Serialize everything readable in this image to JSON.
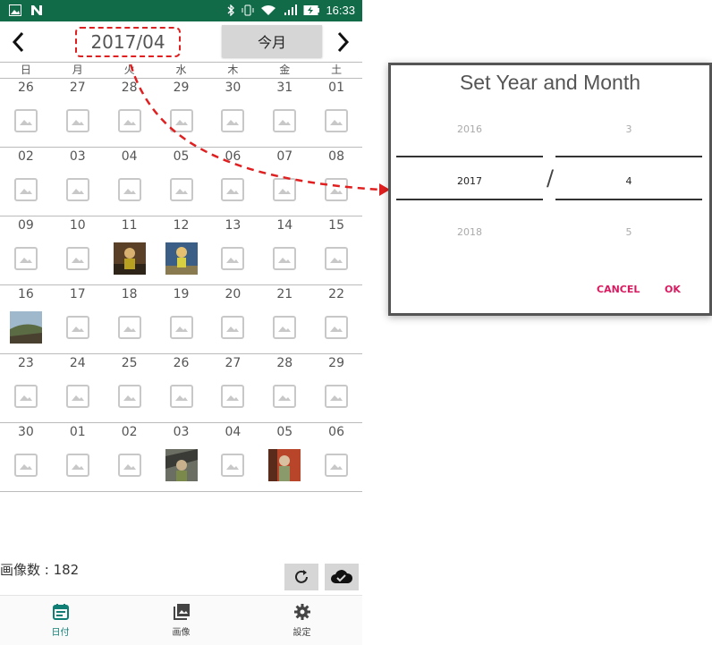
{
  "status_bar": {
    "time": "16:33"
  },
  "header": {
    "year_month": "2017/04",
    "today_button": "今月"
  },
  "calendar": {
    "weekdays": [
      "日",
      "月",
      "火",
      "水",
      "木",
      "金",
      "土"
    ],
    "weeks": [
      [
        "26",
        "27",
        "28",
        "29",
        "30",
        "31",
        "01"
      ],
      [
        "02",
        "03",
        "04",
        "05",
        "06",
        "07",
        "08"
      ],
      [
        "09",
        "10",
        "11",
        "12",
        "13",
        "14",
        "15"
      ],
      [
        "16",
        "17",
        "18",
        "19",
        "20",
        "21",
        "22"
      ],
      [
        "23",
        "24",
        "25",
        "26",
        "27",
        "28",
        "29"
      ],
      [
        "30",
        "01",
        "02",
        "03",
        "04",
        "05",
        "06"
      ]
    ]
  },
  "footer": {
    "image_count": "画像数 : 182"
  },
  "bottom_nav": {
    "items": [
      {
        "label": "日付"
      },
      {
        "label": "画像"
      },
      {
        "label": "設定"
      }
    ]
  },
  "dialog": {
    "title": "Set Year and Month",
    "year_prev": "2016",
    "year_selected": "2017",
    "year_next": "2018",
    "separator": "/",
    "month_prev": "3",
    "month_selected": "4",
    "month_next": "5",
    "cancel": "CANCEL",
    "ok": "OK"
  },
  "colors": {
    "status_bar": "#116b49",
    "accent": "#0f7e74",
    "dialog_button": "#d81b60",
    "annotation": "#e02020"
  }
}
